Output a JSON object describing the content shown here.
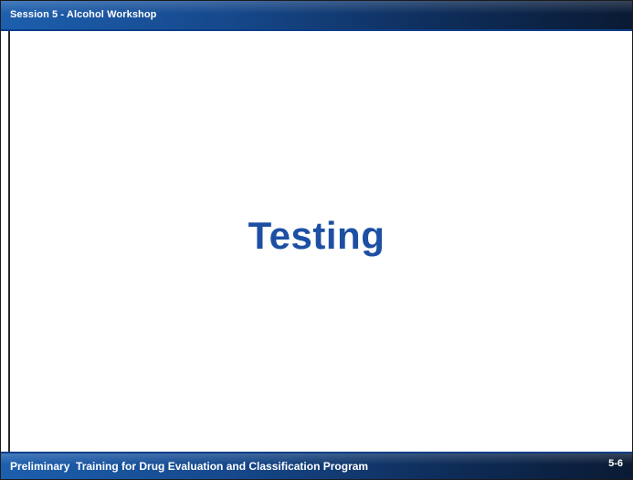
{
  "header": {
    "session_title": "Session 5 - Alcohol Workshop"
  },
  "slide": {
    "title": "Testing"
  },
  "footer": {
    "program_title": "Preliminary  Training for Drug Evaluation and Classification Program",
    "slide_number": "5-6"
  },
  "colors": {
    "bar_blue": "#16498d",
    "bar_dark": "#0a1a33",
    "title_blue": "#1d4fa3",
    "background": "#ffffff"
  }
}
